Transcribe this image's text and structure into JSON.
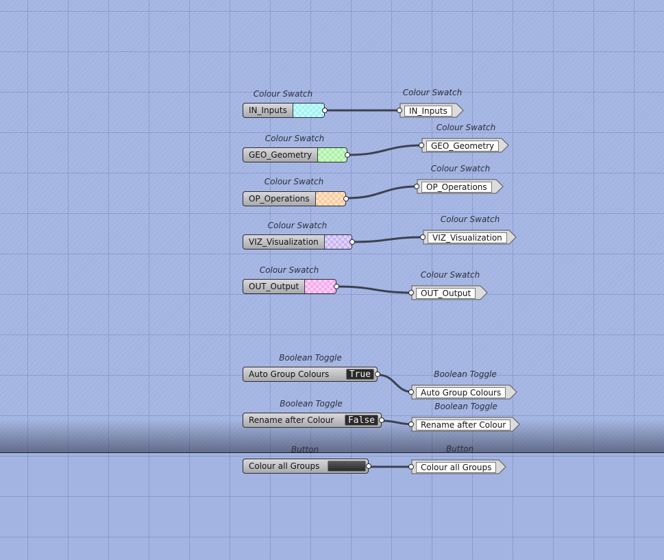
{
  "canvas": {
    "background": "#a3b4e2",
    "wire_color": "#3c4150"
  },
  "swatches": [
    {
      "label": "Colour Swatch",
      "name": "IN_Inputs",
      "color": "#9ef3f3"
    },
    {
      "label": "Colour Swatch",
      "name": "GEO_Geometry",
      "color": "#a9f3a2"
    },
    {
      "label": "Colour Swatch",
      "name": "OP_Operations",
      "color": "#f9cc9c"
    },
    {
      "label": "Colour Swatch",
      "name": "VIZ_Visualization",
      "color": "#c8b2f6"
    },
    {
      "label": "Colour Swatch",
      "name": "OUT_Output",
      "color": "#f6a9ec"
    }
  ],
  "swatch_panels": [
    {
      "label": "Colour Swatch",
      "text": "IN_Inputs"
    },
    {
      "label": "Colour Swatch",
      "text": "GEO_Geometry"
    },
    {
      "label": "Colour Swatch",
      "text": "OP_Operations"
    },
    {
      "label": "Colour Swatch",
      "text": "VIZ_Visualization"
    },
    {
      "label": "Colour Swatch",
      "text": "OUT_Output"
    }
  ],
  "toggles": [
    {
      "label": "Boolean Toggle",
      "name": "Auto Group Colours",
      "value": "True"
    },
    {
      "label": "Boolean Toggle",
      "name": "Rename after Colour",
      "value": "False"
    }
  ],
  "toggle_panels": [
    {
      "label": "Boolean Toggle",
      "text": "Auto Group Colours"
    },
    {
      "label": "Boolean Toggle",
      "text": "Rename after Colour"
    }
  ],
  "button": {
    "label": "Button",
    "name": "Colour all Groups"
  },
  "button_panel": {
    "label": "Button",
    "text": "Colour all Groups"
  }
}
